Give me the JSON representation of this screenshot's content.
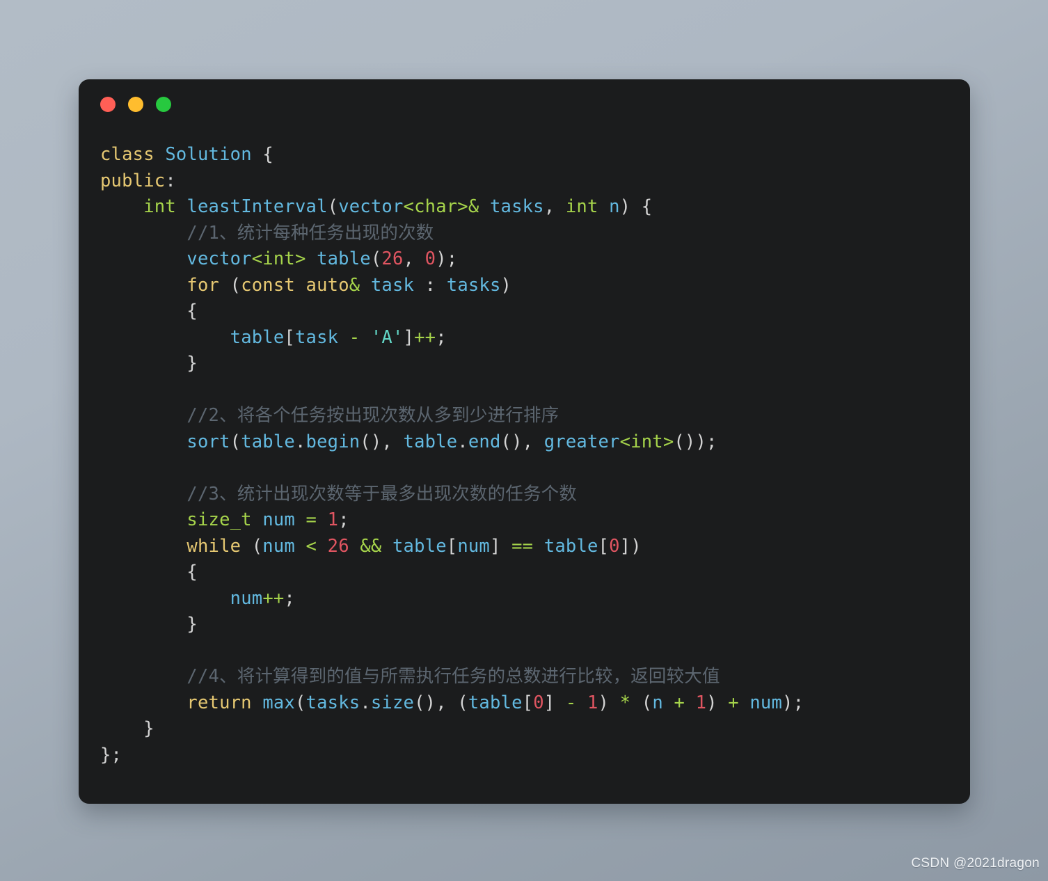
{
  "window": {
    "dots": [
      {
        "name": "close",
        "color": "#ff5f56"
      },
      {
        "name": "minimize",
        "color": "#ffbd2e"
      },
      {
        "name": "maximize",
        "color": "#27c93f"
      }
    ]
  },
  "theme": {
    "card_background": "#1b1c1d",
    "page_background_top": "#b2bcc6",
    "page_background_bottom": "#8e99a5",
    "keyword": "#e6c872",
    "type": "#a6d44b",
    "identifier": "#63b9e0",
    "number": "#e05561",
    "string": "#63d8c8",
    "punctuation": "#d4d4d4",
    "comment": "#5c6670"
  },
  "code": {
    "language": "cpp",
    "lines": [
      {
        "n": 1,
        "tokens": [
          {
            "t": "class",
            "c": "kw"
          },
          {
            "t": " ",
            "c": "pun"
          },
          {
            "t": "Solution",
            "c": "id"
          },
          {
            "t": " ",
            "c": "pun"
          },
          {
            "t": "{",
            "c": "pun"
          }
        ]
      },
      {
        "n": 2,
        "tokens": [
          {
            "t": "public",
            "c": "kw"
          },
          {
            "t": ":",
            "c": "pun"
          }
        ]
      },
      {
        "n": 3,
        "tokens": [
          {
            "t": "    ",
            "c": "pun"
          },
          {
            "t": "int",
            "c": "typ"
          },
          {
            "t": " ",
            "c": "pun"
          },
          {
            "t": "leastInterval",
            "c": "id"
          },
          {
            "t": "(",
            "c": "pun"
          },
          {
            "t": "vector",
            "c": "id"
          },
          {
            "t": "<char>",
            "c": "typ"
          },
          {
            "t": "& ",
            "c": "typ"
          },
          {
            "t": "tasks",
            "c": "id"
          },
          {
            "t": ", ",
            "c": "pun"
          },
          {
            "t": "int",
            "c": "typ"
          },
          {
            "t": " ",
            "c": "pun"
          },
          {
            "t": "n",
            "c": "id"
          },
          {
            "t": ") {",
            "c": "pun"
          }
        ]
      },
      {
        "n": 4,
        "tokens": [
          {
            "t": "        ",
            "c": "pun"
          },
          {
            "t": "//1、统计每种任务出现的次数",
            "c": "cmt"
          }
        ]
      },
      {
        "n": 5,
        "tokens": [
          {
            "t": "        ",
            "c": "pun"
          },
          {
            "t": "vector",
            "c": "id"
          },
          {
            "t": "<int>",
            "c": "typ"
          },
          {
            "t": " ",
            "c": "pun"
          },
          {
            "t": "table",
            "c": "id"
          },
          {
            "t": "(",
            "c": "pun"
          },
          {
            "t": "26",
            "c": "num"
          },
          {
            "t": ", ",
            "c": "pun"
          },
          {
            "t": "0",
            "c": "num"
          },
          {
            "t": ");",
            "c": "pun"
          }
        ]
      },
      {
        "n": 6,
        "tokens": [
          {
            "t": "        ",
            "c": "pun"
          },
          {
            "t": "for",
            "c": "kw"
          },
          {
            "t": " (",
            "c": "pun"
          },
          {
            "t": "const",
            "c": "kw"
          },
          {
            "t": " ",
            "c": "pun"
          },
          {
            "t": "auto",
            "c": "kw"
          },
          {
            "t": "&",
            "c": "typ"
          },
          {
            "t": " ",
            "c": "pun"
          },
          {
            "t": "task",
            "c": "id"
          },
          {
            "t": " : ",
            "c": "pun"
          },
          {
            "t": "tasks",
            "c": "id"
          },
          {
            "t": ")",
            "c": "pun"
          }
        ]
      },
      {
        "n": 7,
        "tokens": [
          {
            "t": "        {",
            "c": "pun"
          }
        ]
      },
      {
        "n": 8,
        "tokens": [
          {
            "t": "            ",
            "c": "pun"
          },
          {
            "t": "table",
            "c": "id"
          },
          {
            "t": "[",
            "c": "pun"
          },
          {
            "t": "task",
            "c": "id"
          },
          {
            "t": " ",
            "c": "pun"
          },
          {
            "t": "-",
            "c": "op"
          },
          {
            "t": " ",
            "c": "pun"
          },
          {
            "t": "'A'",
            "c": "str"
          },
          {
            "t": "]",
            "c": "pun"
          },
          {
            "t": "++",
            "c": "op"
          },
          {
            "t": ";",
            "c": "pun"
          }
        ]
      },
      {
        "n": 9,
        "tokens": [
          {
            "t": "        }",
            "c": "pun"
          }
        ]
      },
      {
        "n": 10,
        "tokens": []
      },
      {
        "n": 11,
        "tokens": [
          {
            "t": "        ",
            "c": "pun"
          },
          {
            "t": "//2、将各个任务按出现次数从多到少进行排序",
            "c": "cmt"
          }
        ]
      },
      {
        "n": 12,
        "tokens": [
          {
            "t": "        ",
            "c": "pun"
          },
          {
            "t": "sort",
            "c": "id"
          },
          {
            "t": "(",
            "c": "pun"
          },
          {
            "t": "table",
            "c": "id"
          },
          {
            "t": ".",
            "c": "pun"
          },
          {
            "t": "begin",
            "c": "id"
          },
          {
            "t": "(), ",
            "c": "pun"
          },
          {
            "t": "table",
            "c": "id"
          },
          {
            "t": ".",
            "c": "pun"
          },
          {
            "t": "end",
            "c": "id"
          },
          {
            "t": "(), ",
            "c": "pun"
          },
          {
            "t": "greater",
            "c": "id"
          },
          {
            "t": "<int>",
            "c": "typ"
          },
          {
            "t": "());",
            "c": "pun"
          }
        ]
      },
      {
        "n": 13,
        "tokens": []
      },
      {
        "n": 14,
        "tokens": [
          {
            "t": "        ",
            "c": "pun"
          },
          {
            "t": "//3、统计出现次数等于最多出现次数的任务个数",
            "c": "cmt"
          }
        ]
      },
      {
        "n": 15,
        "tokens": [
          {
            "t": "        ",
            "c": "pun"
          },
          {
            "t": "size_t",
            "c": "typ"
          },
          {
            "t": " ",
            "c": "pun"
          },
          {
            "t": "num",
            "c": "id"
          },
          {
            "t": " ",
            "c": "pun"
          },
          {
            "t": "=",
            "c": "op"
          },
          {
            "t": " ",
            "c": "pun"
          },
          {
            "t": "1",
            "c": "num"
          },
          {
            "t": ";",
            "c": "pun"
          }
        ]
      },
      {
        "n": 16,
        "tokens": [
          {
            "t": "        ",
            "c": "pun"
          },
          {
            "t": "while",
            "c": "kw"
          },
          {
            "t": " (",
            "c": "pun"
          },
          {
            "t": "num",
            "c": "id"
          },
          {
            "t": " ",
            "c": "pun"
          },
          {
            "t": "<",
            "c": "op"
          },
          {
            "t": " ",
            "c": "pun"
          },
          {
            "t": "26",
            "c": "num"
          },
          {
            "t": " ",
            "c": "pun"
          },
          {
            "t": "&&",
            "c": "op"
          },
          {
            "t": " ",
            "c": "pun"
          },
          {
            "t": "table",
            "c": "id"
          },
          {
            "t": "[",
            "c": "pun"
          },
          {
            "t": "num",
            "c": "id"
          },
          {
            "t": "] ",
            "c": "pun"
          },
          {
            "t": "==",
            "c": "op"
          },
          {
            "t": " ",
            "c": "pun"
          },
          {
            "t": "table",
            "c": "id"
          },
          {
            "t": "[",
            "c": "pun"
          },
          {
            "t": "0",
            "c": "num"
          },
          {
            "t": "])",
            "c": "pun"
          }
        ]
      },
      {
        "n": 17,
        "tokens": [
          {
            "t": "        {",
            "c": "pun"
          }
        ]
      },
      {
        "n": 18,
        "tokens": [
          {
            "t": "            ",
            "c": "pun"
          },
          {
            "t": "num",
            "c": "id"
          },
          {
            "t": "++",
            "c": "op"
          },
          {
            "t": ";",
            "c": "pun"
          }
        ]
      },
      {
        "n": 19,
        "tokens": [
          {
            "t": "        }",
            "c": "pun"
          }
        ]
      },
      {
        "n": 20,
        "tokens": []
      },
      {
        "n": 21,
        "tokens": [
          {
            "t": "        ",
            "c": "pun"
          },
          {
            "t": "//4、将计算得到的值与所需执行任务的总数进行比较，返回较大值",
            "c": "cmt"
          }
        ]
      },
      {
        "n": 22,
        "tokens": [
          {
            "t": "        ",
            "c": "pun"
          },
          {
            "t": "return",
            "c": "kw"
          },
          {
            "t": " ",
            "c": "pun"
          },
          {
            "t": "max",
            "c": "id"
          },
          {
            "t": "(",
            "c": "pun"
          },
          {
            "t": "tasks",
            "c": "id"
          },
          {
            "t": ".",
            "c": "pun"
          },
          {
            "t": "size",
            "c": "id"
          },
          {
            "t": "(), (",
            "c": "pun"
          },
          {
            "t": "table",
            "c": "id"
          },
          {
            "t": "[",
            "c": "pun"
          },
          {
            "t": "0",
            "c": "num"
          },
          {
            "t": "] ",
            "c": "pun"
          },
          {
            "t": "-",
            "c": "op"
          },
          {
            "t": " ",
            "c": "pun"
          },
          {
            "t": "1",
            "c": "num"
          },
          {
            "t": ") ",
            "c": "pun"
          },
          {
            "t": "*",
            "c": "op"
          },
          {
            "t": " (",
            "c": "pun"
          },
          {
            "t": "n",
            "c": "id"
          },
          {
            "t": " ",
            "c": "pun"
          },
          {
            "t": "+",
            "c": "op"
          },
          {
            "t": " ",
            "c": "pun"
          },
          {
            "t": "1",
            "c": "num"
          },
          {
            "t": ") ",
            "c": "pun"
          },
          {
            "t": "+",
            "c": "op"
          },
          {
            "t": " ",
            "c": "pun"
          },
          {
            "t": "num",
            "c": "id"
          },
          {
            "t": ");",
            "c": "pun"
          }
        ]
      },
      {
        "n": 23,
        "tokens": [
          {
            "t": "    }",
            "c": "pun"
          }
        ]
      },
      {
        "n": 24,
        "tokens": [
          {
            "t": "};",
            "c": "pun"
          }
        ]
      }
    ]
  },
  "watermark": {
    "text": "CSDN @2021dragon"
  }
}
